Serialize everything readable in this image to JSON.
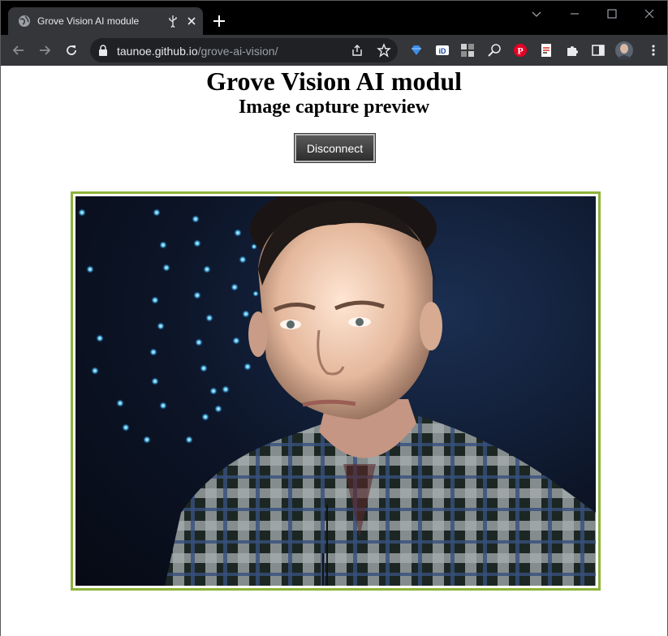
{
  "browser": {
    "tab_title": "Grove Vision AI module",
    "url_domain": "taunoe.github.io",
    "url_path": "/grove-ai-vision/",
    "tab_bg": "#35363a",
    "strip_bg": "#000000"
  },
  "page": {
    "title": "Grove Vision AI modul",
    "subtitle": "Image capture preview",
    "disconnect_label": "Disconnect",
    "frame_color": "#8db33b"
  },
  "icons": {
    "tab": [
      "globe-icon",
      "usb-icon",
      "close-icon"
    ],
    "window": [
      "chevron-down-icon",
      "minimize-icon",
      "maximize-icon",
      "close-window-icon"
    ],
    "toolbar": [
      "back-icon",
      "forward-icon",
      "reload-icon",
      "lock-icon",
      "share-icon",
      "star-icon"
    ],
    "extensions": [
      "gem-icon",
      "id-icon",
      "grid-icon",
      "eyedropper-icon",
      "pinterest-icon",
      "page-icon",
      "puzzle-icon",
      "sidepanel-icon",
      "avatar",
      "kebab-menu-icon"
    ]
  }
}
